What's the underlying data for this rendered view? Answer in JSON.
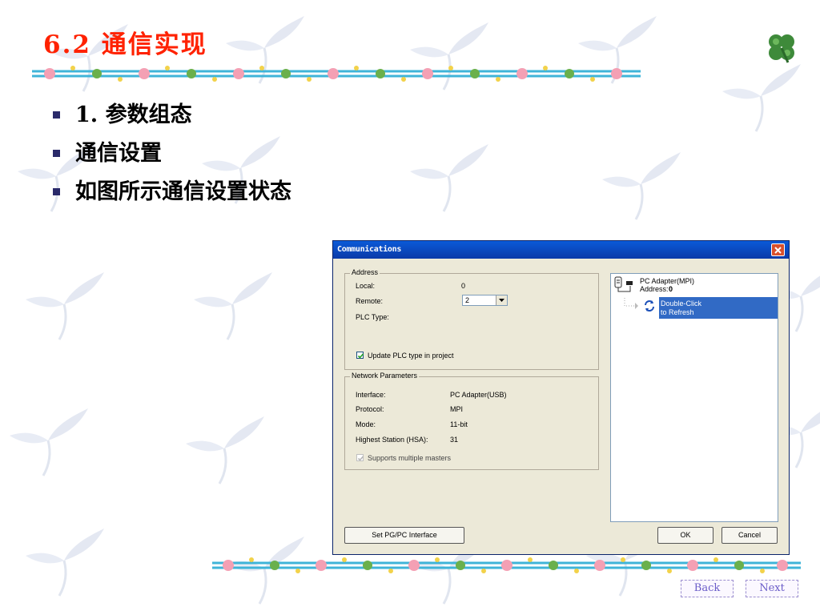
{
  "slide": {
    "title": "6.2 通信实现",
    "bullets": [
      "1. 参数组态",
      "通信设置",
      "如图所示通信设置状态"
    ]
  },
  "dialog": {
    "title": "Communications",
    "address_group": {
      "legend": "Address",
      "local_label": "Local:",
      "local_value": "0",
      "remote_label": "Remote:",
      "remote_value": "2",
      "plc_type_label": "PLC Type:",
      "update_checkbox_label": "Update PLC type in project",
      "update_checked": true
    },
    "network_group": {
      "legend": "Network Parameters",
      "interface_label": "Interface:",
      "interface_value": "PC Adapter(USB)",
      "protocol_label": "Protocol:",
      "protocol_value": "MPI",
      "mode_label": "Mode:",
      "mode_value": "11-bit",
      "hsa_label": "Highest Station (HSA):",
      "hsa_value": "31",
      "multi_master_label": "Supports multiple masters",
      "multi_master_checked": true
    },
    "tree": {
      "adapter_name": "PC Adapter(MPI)",
      "address_label": "Address:",
      "address_value": "0",
      "refresh_line1": "Double-Click",
      "refresh_line2": "to Refresh"
    },
    "buttons": {
      "set_pgpc": "Set PG/PC Interface",
      "ok": "OK",
      "cancel": "Cancel"
    }
  },
  "nav": {
    "back": "Back",
    "next": "Next"
  },
  "colors": {
    "title": "#ff2200",
    "titlebar": "#0a46c8",
    "highlight": "#316ac5"
  }
}
